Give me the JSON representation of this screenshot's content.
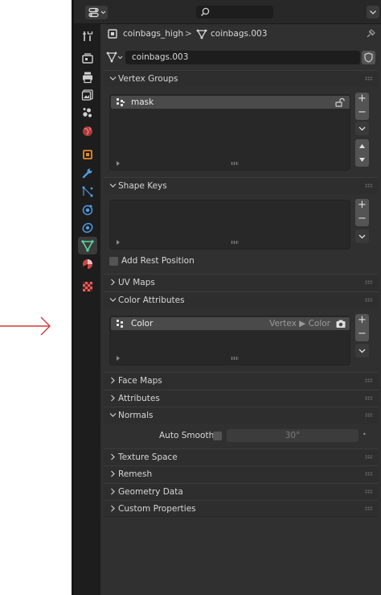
{
  "header": {
    "editor_type_icon": "properties-editor-icon",
    "search_icon": "search-icon"
  },
  "breadcrumb": {
    "object_name": "coinbags_high",
    "separator": ">",
    "mesh_name": "coinbags.003"
  },
  "data_block": {
    "name": "coinbags.003"
  },
  "tabs": [
    "tool-icon",
    "render-icon",
    "output-icon",
    "view-layer-icon",
    "scene-icon",
    "world-icon",
    "object-icon",
    "modifier-icon",
    "particles-icon",
    "physics-icon",
    "constraints-icon",
    "mesh-data-icon",
    "material-icon",
    "texture-icon"
  ],
  "panels": {
    "vertex_groups": {
      "title": "Vertex Groups",
      "items": [
        {
          "name": "mask"
        }
      ],
      "add": "+",
      "remove": "−"
    },
    "shape_keys": {
      "title": "Shape Keys",
      "add": "+",
      "remove": "−",
      "add_rest_position": "Add Rest Position"
    },
    "uv_maps": {
      "title": "UV Maps"
    },
    "color_attributes": {
      "title": "Color Attributes",
      "items": [
        {
          "name": "Color",
          "domain": "Vertex ▶ Color"
        }
      ],
      "add": "+",
      "remove": "−"
    },
    "face_maps": {
      "title": "Face Maps"
    },
    "attributes": {
      "title": "Attributes"
    },
    "normals": {
      "title": "Normals",
      "auto_smooth_label": "Auto Smooth",
      "auto_smooth_angle": "30°",
      "dot": "•"
    },
    "texture_space": {
      "title": "Texture Space"
    },
    "remesh": {
      "title": "Remesh"
    },
    "geometry_data": {
      "title": "Geometry Data"
    },
    "custom_properties": {
      "title": "Custom Properties"
    }
  },
  "colors": {
    "annotation_arrow": "#d23a3a",
    "active_tab": "#3b3b3b",
    "list_selected": "#4a4a4a",
    "mesh_data_green": "#5bd6a1"
  }
}
